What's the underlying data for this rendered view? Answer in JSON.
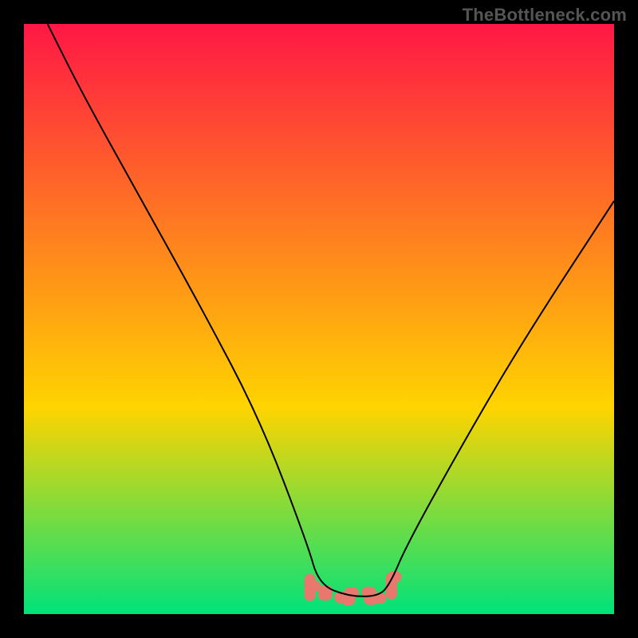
{
  "watermark": "TheBottleneck.com",
  "chart_data": {
    "type": "line",
    "title": "",
    "xlabel": "",
    "ylabel": "",
    "xlim": [
      0,
      100
    ],
    "ylim": [
      0,
      100
    ],
    "grid": false,
    "legend": false,
    "background_gradient": [
      "#ff1745",
      "#ffd400",
      "#00e27a"
    ],
    "series": [
      {
        "name": "bottleneck-curve",
        "color": "#000000",
        "x": [
          4,
          10,
          20,
          30,
          40,
          48,
          50,
          55,
          60,
          62,
          65,
          75,
          85,
          100
        ],
        "y": [
          100,
          88,
          70,
          52,
          33,
          12,
          5,
          3,
          3,
          5,
          12,
          30,
          47,
          70
        ]
      }
    ],
    "markers": {
      "name": "highlight-band",
      "color": "#e8776d",
      "x_range": [
        49,
        62
      ],
      "y": 3
    }
  }
}
